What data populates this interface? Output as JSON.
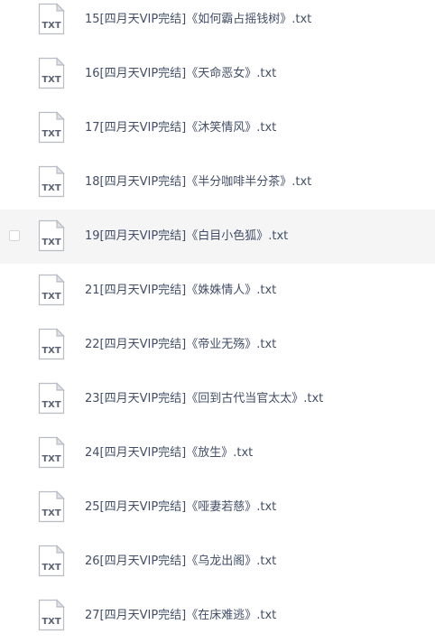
{
  "file_icon": {
    "name": "txt-file-icon",
    "label": "TXT",
    "colors": {
      "outline": "#b8bdc4",
      "fold": "#dfe2e6",
      "label": "#5b6273"
    }
  },
  "hovered_row": 4,
  "files": [
    {
      "name": "15[四月天VIP完结]《如何霸占摇钱树》.txt"
    },
    {
      "name": "16[四月天VIP完结]《天命恶女》.txt"
    },
    {
      "name": "17[四月天VIP完结]《沐笑情风》.txt"
    },
    {
      "name": "18[四月天VIP完结]《半分咖啡半分茶》.txt"
    },
    {
      "name": "19[四月天VIP完结]《白目小色狐》.txt"
    },
    {
      "name": "21[四月天VIP完结]《姝姝情人》.txt"
    },
    {
      "name": "22[四月天VIP完结]《帝业无殇》.txt"
    },
    {
      "name": "23[四月天VIP完结]《回到古代当官太太》.txt"
    },
    {
      "name": "24[四月天VIP完结]《放生》.txt"
    },
    {
      "name": "25[四月天VIP完结]《哑妻若慈》.txt"
    },
    {
      "name": "26[四月天VIP完结]《乌龙出阁》.txt"
    },
    {
      "name": "27[四月天VIP完结]《在床难逃》.txt"
    }
  ]
}
